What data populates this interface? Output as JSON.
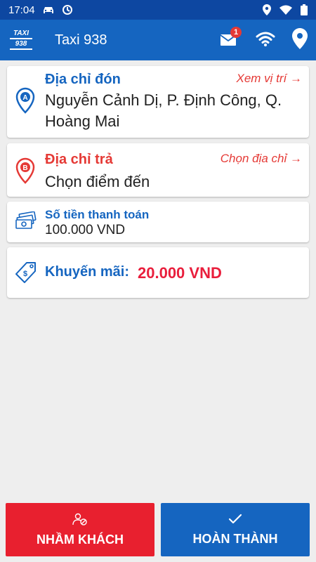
{
  "status_bar": {
    "time": "17:04"
  },
  "app_bar": {
    "logo_line1": "TAXI",
    "logo_line2": "938",
    "title": "Taxi 938",
    "mail_badge": "1"
  },
  "pickup": {
    "label": "Địa chỉ đón",
    "link": "Xem vị trí →",
    "pin_letter": "A",
    "address": "Nguyễn Cảnh Dị, P. Định Công, Q. Hoàng Mai"
  },
  "dropoff": {
    "label": "Địa chỉ trả",
    "link": "Chọn địa chỉ →",
    "pin_letter": "B",
    "address": "Chọn điểm đến"
  },
  "payment": {
    "label": "Số tiền thanh toán",
    "amount": "100.000 VND"
  },
  "promotion": {
    "label": "Khuyến mãi:",
    "amount": "20.000 VND"
  },
  "actions": {
    "wrong_customer": "NHẦM KHÁCH",
    "complete": "HOÀN THÀNH"
  },
  "colors": {
    "primary": "#1565c0",
    "status_bar": "#0d47a1",
    "accent_red": "#e53935",
    "wrong_button": "#e8202f"
  }
}
